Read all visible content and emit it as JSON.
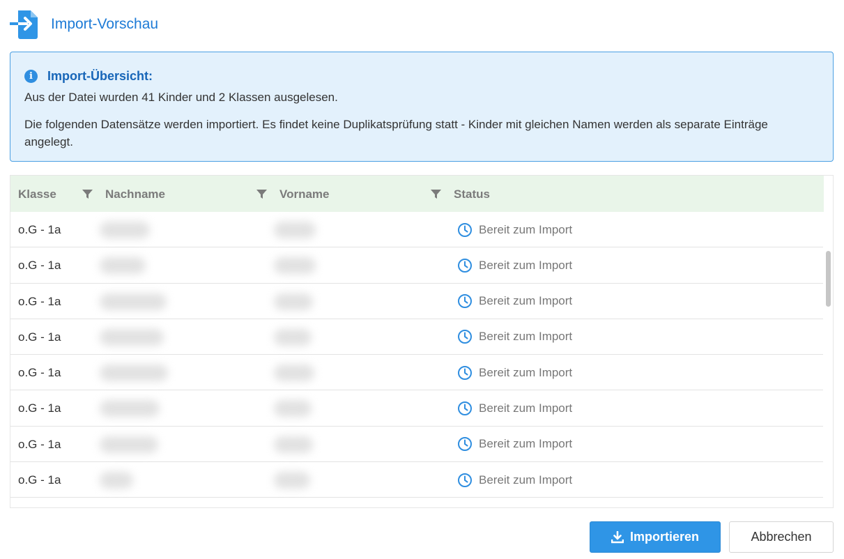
{
  "dialog": {
    "title": "Import-Vorschau",
    "icon": "file-import-icon"
  },
  "info": {
    "icon": "info-icon",
    "heading": "Import-Übersicht:",
    "line1": "Aus der Datei wurden 41 Kinder und 2 Klassen ausgelesen.",
    "line2": "Die folgenden Datensätze werden importiert. Es findet keine Duplikatsprüfung statt - Kinder mit gleichen Namen werden als separate Einträge angelegt."
  },
  "table": {
    "columns": [
      "Klasse",
      "Nachname",
      "Vorname",
      "Status"
    ],
    "rows": [
      {
        "klasse": "o.G - 1a",
        "status": "Bereit zum Import"
      },
      {
        "klasse": "o.G - 1a",
        "status": "Bereit zum Import"
      },
      {
        "klasse": "o.G - 1a",
        "status": "Bereit zum Import"
      },
      {
        "klasse": "o.G - 1a",
        "status": "Bereit zum Import"
      },
      {
        "klasse": "o.G - 1a",
        "status": "Bereit zum Import"
      },
      {
        "klasse": "o.G - 1a",
        "status": "Bereit zum Import"
      },
      {
        "klasse": "o.G - 1a",
        "status": "Bereit zum Import"
      },
      {
        "klasse": "o.G - 1a",
        "status": "Bereit zum Import"
      }
    ]
  },
  "buttons": {
    "import_label": "Importieren",
    "cancel_label": "Abbrechen"
  },
  "colors": {
    "accent": "#2f95e6",
    "title": "#1e7bd6",
    "info_bg": "#e3f1fc",
    "header_bg": "#e9f5e9"
  }
}
